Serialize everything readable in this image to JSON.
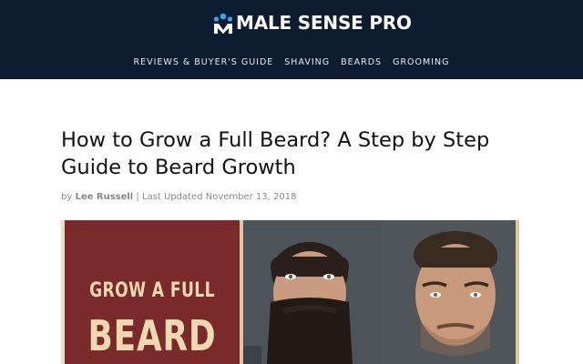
{
  "site": {
    "name": "MALE SENSE PRO",
    "brand_colors": {
      "header_bg": "#0d1c31",
      "logo_accent": "#3aa7e0"
    }
  },
  "nav": {
    "items": [
      {
        "label": "REVIEWS & BUYER'S GUIDE"
      },
      {
        "label": "SHAVING"
      },
      {
        "label": "BEARDS"
      },
      {
        "label": "GROOMING"
      }
    ]
  },
  "article": {
    "title": "How to Grow a Full Beard? A Step by Step Guide to Beard Growth",
    "by": "by",
    "author": "Lee Russell",
    "separator": "|",
    "updated": "Last Updated November 13, 2018",
    "hero": {
      "line1": "GROW A FULL",
      "line2": "BEARD"
    }
  },
  "icons": {
    "logo": "people-group-icon"
  }
}
